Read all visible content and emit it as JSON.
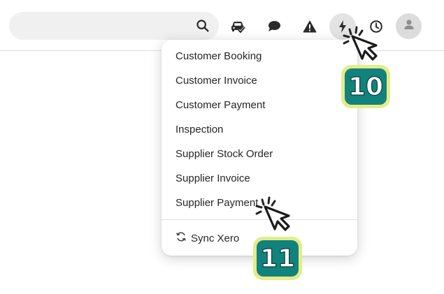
{
  "search": {
    "placeholder": ""
  },
  "toolbar": {
    "icons": [
      "search-icon",
      "car-check-icon",
      "chat-bubble-icon",
      "warning-icon",
      "lightning-bolt-icon",
      "clock-icon",
      "user-avatar-icon"
    ]
  },
  "menu": {
    "items": [
      {
        "label": "Customer Booking"
      },
      {
        "label": "Customer Invoice"
      },
      {
        "label": "Customer Payment"
      },
      {
        "label": "Inspection"
      },
      {
        "label": "Supplier Stock Order"
      },
      {
        "label": "Supplier Invoice"
      },
      {
        "label": "Supplier Payment"
      }
    ],
    "sync": {
      "label": "Sync Xero",
      "icon": "sync-icon"
    }
  },
  "annotations": {
    "step_1": "10",
    "step_2": "11"
  },
  "colors": {
    "badge_fill": "#12827c",
    "badge_border": "#e4ec8a",
    "active_button_bg": "#e3e3e3",
    "icon_color": "#2b2b2b"
  }
}
